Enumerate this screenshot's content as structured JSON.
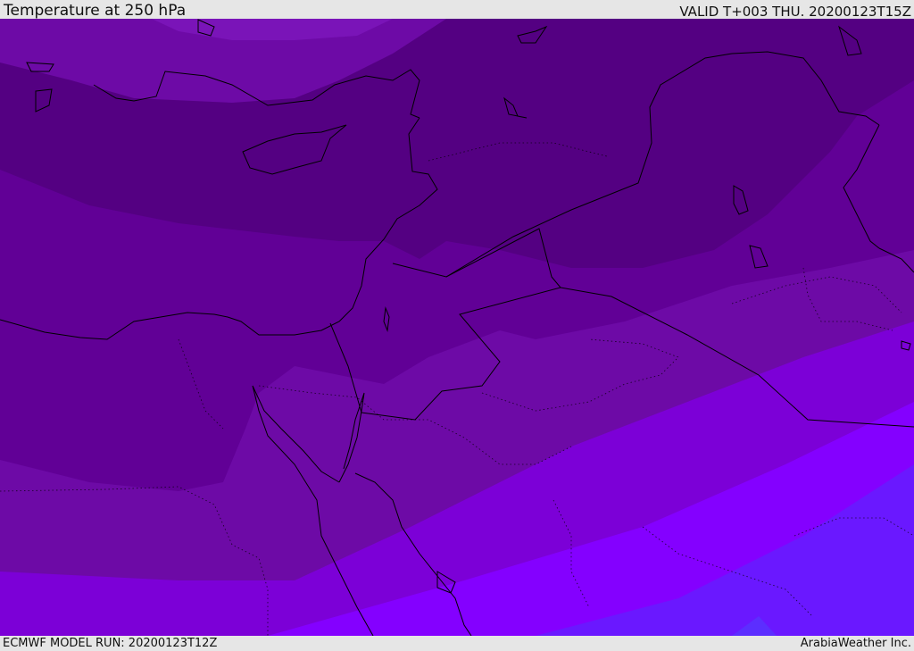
{
  "header": {
    "title": "Temperature at 250 hPa",
    "valid": "VALID T+003 THU. 20200123T15Z"
  },
  "footer": {
    "model_run": "ECMWF MODEL RUN: 20200123T12Z",
    "credit": "ArabiaWeather Inc."
  },
  "map": {
    "variable": "temperature",
    "level": "250 hPa",
    "colors": {
      "band_darkest": "#540082",
      "band_dark": "#610096",
      "band_mid": "#6d0aa6",
      "band_light": "#7c00d7",
      "band_bright": "#8400ff",
      "band_blue": "#6a18ff",
      "band_bluer": "#5c2eff",
      "coastline": "#000000"
    }
  }
}
